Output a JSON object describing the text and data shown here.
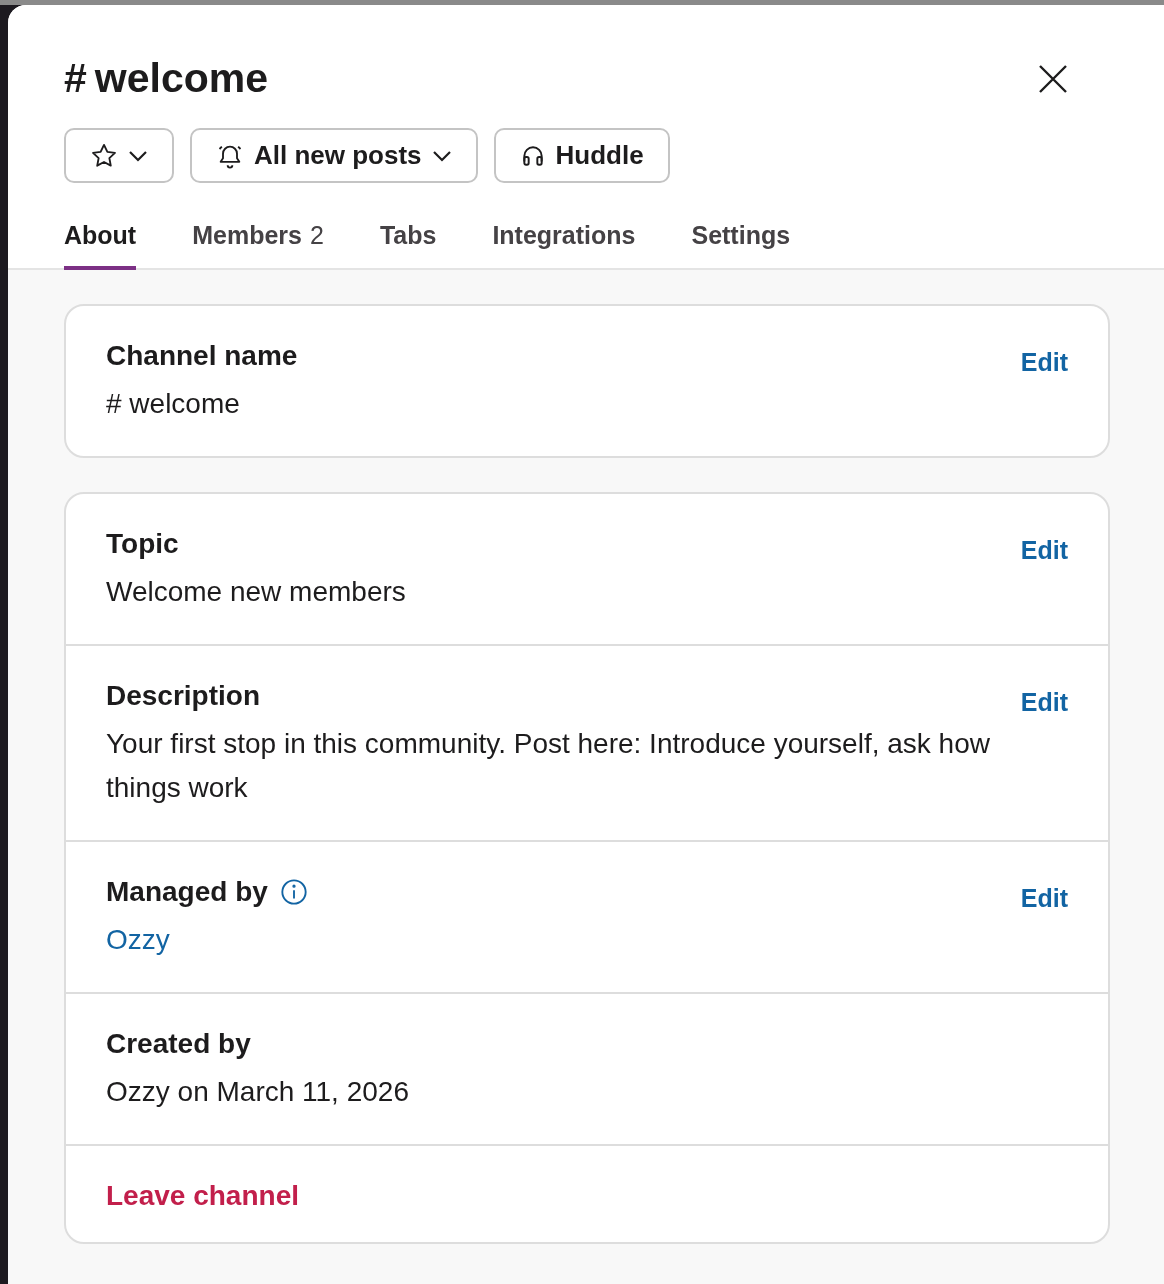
{
  "header": {
    "hash": "#",
    "title": "welcome",
    "starred": false,
    "notifications": "All new posts",
    "huddle": "Huddle"
  },
  "tabs": [
    {
      "label": "About",
      "selected": true
    },
    {
      "label": "Members",
      "count": "2",
      "selected": false
    },
    {
      "label": "Tabs",
      "selected": false
    },
    {
      "label": "Integrations",
      "selected": false
    },
    {
      "label": "Settings",
      "selected": false
    }
  ],
  "cards": [
    {
      "rows": [
        {
          "kind": "field",
          "label": "Channel name",
          "value": "# welcome",
          "action": "Edit"
        }
      ]
    },
    {
      "rows": [
        {
          "kind": "field",
          "label": "Topic",
          "value": "Welcome new members",
          "action": "Edit"
        },
        {
          "kind": "field",
          "label": "Description",
          "value": "Your first stop in this community. Post here: Introduce yourself, ask how things work",
          "action": "Edit"
        },
        {
          "kind": "person",
          "label": "Managed by",
          "info": true,
          "value": "Ozzy",
          "action": "Edit"
        },
        {
          "kind": "field",
          "label": "Created by",
          "value": "Ozzy on March 11, 2026"
        },
        {
          "kind": "danger",
          "label": "Leave channel"
        }
      ]
    }
  ]
}
